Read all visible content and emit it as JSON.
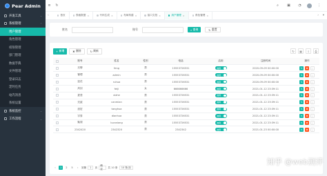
{
  "app": {
    "title": "Pear Admin"
  },
  "sidebar": {
    "items": [
      {
        "label": "开发工具",
        "type": "group"
      },
      {
        "label": "系统管理",
        "type": "group-open"
      },
      {
        "label": "用户管理",
        "type": "active"
      },
      {
        "label": "角色管理",
        "type": "sub"
      },
      {
        "label": "权限管理",
        "type": "sub"
      },
      {
        "label": "部门管理",
        "type": "sub"
      },
      {
        "label": "数据字典",
        "type": "sub"
      },
      {
        "label": "文件管理",
        "type": "sub"
      },
      {
        "label": "登录日志",
        "type": "sub"
      },
      {
        "label": "定时任务",
        "type": "sub"
      },
      {
        "label": "站内消息",
        "type": "sub"
      },
      {
        "label": "系统设置",
        "type": "sub"
      },
      {
        "label": "系统监控",
        "type": "group"
      },
      {
        "label": "工作流程",
        "type": "group"
      }
    ]
  },
  "tabs": [
    {
      "label": "首页",
      "active": false
    },
    {
      "label": "表格数据",
      "active": false
    },
    {
      "label": "代码生成",
      "active": false
    },
    {
      "label": "布局构建",
      "active": false
    },
    {
      "label": "接口文档",
      "active": false
    },
    {
      "label": "用户管理",
      "active": true
    },
    {
      "label": "角色管理",
      "active": false
    }
  ],
  "search": {
    "field1_label": "姓名",
    "field2_label": "账号",
    "query_label": "查询",
    "reset_label": "重置"
  },
  "toolbar": {
    "add_label": "新增",
    "delete_label": "删除",
    "refresh_label": "刷新"
  },
  "table": {
    "headers": [
      "账号",
      "姓名",
      "性别",
      "电话",
      "启用",
      "注册时间",
      "操作"
    ],
    "rows": [
      [
        "无聊",
        "feng",
        "男",
        "15553726531",
        "启用",
        "2020-09-09 00:00:00"
      ],
      [
        "管理",
        "admin",
        "男",
        "15553726531",
        "启用",
        "2020-09-09 00:00:00"
      ],
      [
        "如花",
        "ruhua",
        "男",
        "15553726531",
        "启用",
        "2020-09-09 00:00:00"
      ],
      [
        "风剑",
        "feiji",
        "女",
        "666666666",
        "启用",
        "2021-01-12 23:39:11"
      ],
      [
        "夏悲",
        "xiahe",
        "男",
        "15553726531",
        "启用",
        "2021-01-12 23:39:11"
      ],
      [
        "无敌",
        "canmian",
        "男",
        "15553726531",
        "启用",
        "2021-01-12 23:39:11"
      ],
      [
        "涨宏",
        "tanghua",
        "男",
        "15553726531",
        "启用",
        "2021-01-12 23:39:11"
      ],
      [
        "宇秀",
        "dianhua",
        "男",
        "15553726531",
        "启用",
        "2021-01-12 23:39:11"
      ],
      [
        "聚观",
        "lucaniang",
        "男",
        "15553726531",
        "启用",
        "2021-01-12 23:39:11"
      ],
      [
        "2342420",
        "2342320",
        "男",
        "2342342",
        "启用",
        "2021-01-23 00:00:00"
      ]
    ]
  },
  "pager": {
    "pages": [
      "1",
      "2",
      "5"
    ],
    "goto_label": "到第",
    "page_input": "1",
    "page_unit": "页",
    "confirm_label": "确定",
    "total": "共 10 条",
    "size": "10 条/页"
  },
  "watermark": "知乎 @web测评",
  "colors": {
    "accent": "#16baaa",
    "danger": "#ff5722",
    "sidebar": "#28333e"
  }
}
